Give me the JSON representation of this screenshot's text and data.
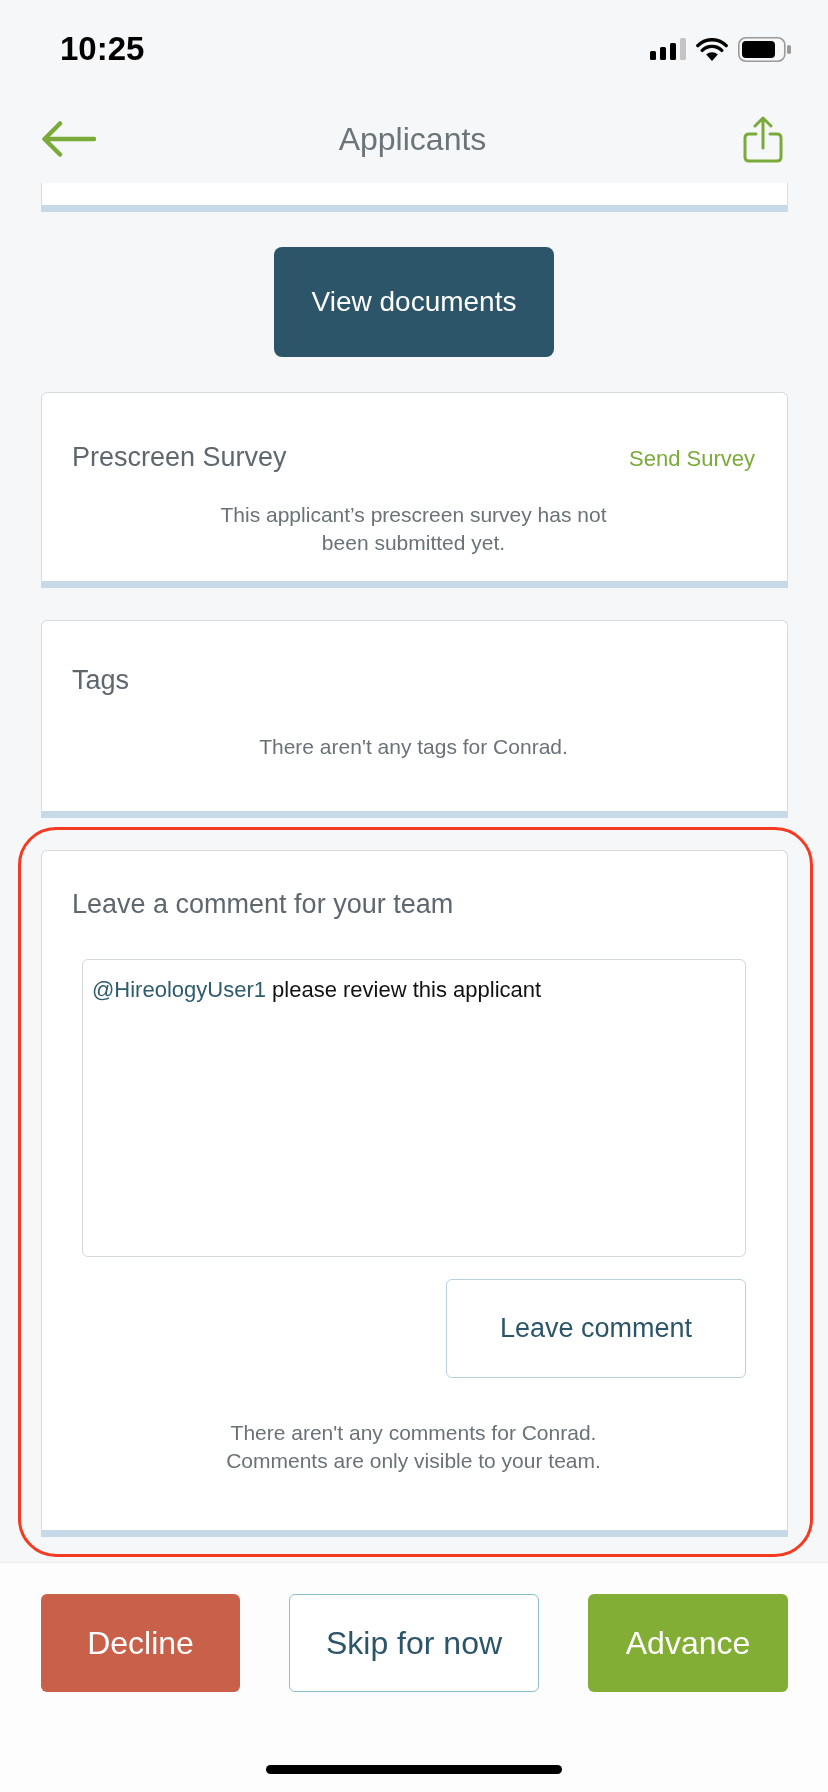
{
  "status_bar": {
    "time": "10:25"
  },
  "header": {
    "title": "Applicants"
  },
  "documents_button": {
    "label": "View documents"
  },
  "sections": [
    {
      "kind": "survey",
      "highlighted": false,
      "title": "Prescreen Survey",
      "action": "Send Survey",
      "message": "This applicant’s prescreen survey has not been submitted yet."
    },
    {
      "kind": "tags",
      "highlighted": false,
      "title": "Tags",
      "message": "There aren't any tags for Conrad."
    },
    {
      "kind": "comments",
      "highlighted": true,
      "title": "Leave a comment for your team",
      "comment_field": {
        "mention": "@HireologyUser1",
        "value": "please review this applicant"
      },
      "submit_button": "Leave comment",
      "message": "There aren't any comments for Conrad. Comments are only visible to your team."
    }
  ],
  "actions": [
    {
      "kind": "decline",
      "label": "Decline"
    },
    {
      "kind": "skip",
      "label": "Skip for now"
    },
    {
      "kind": "advance",
      "label": "Advance"
    }
  ]
}
